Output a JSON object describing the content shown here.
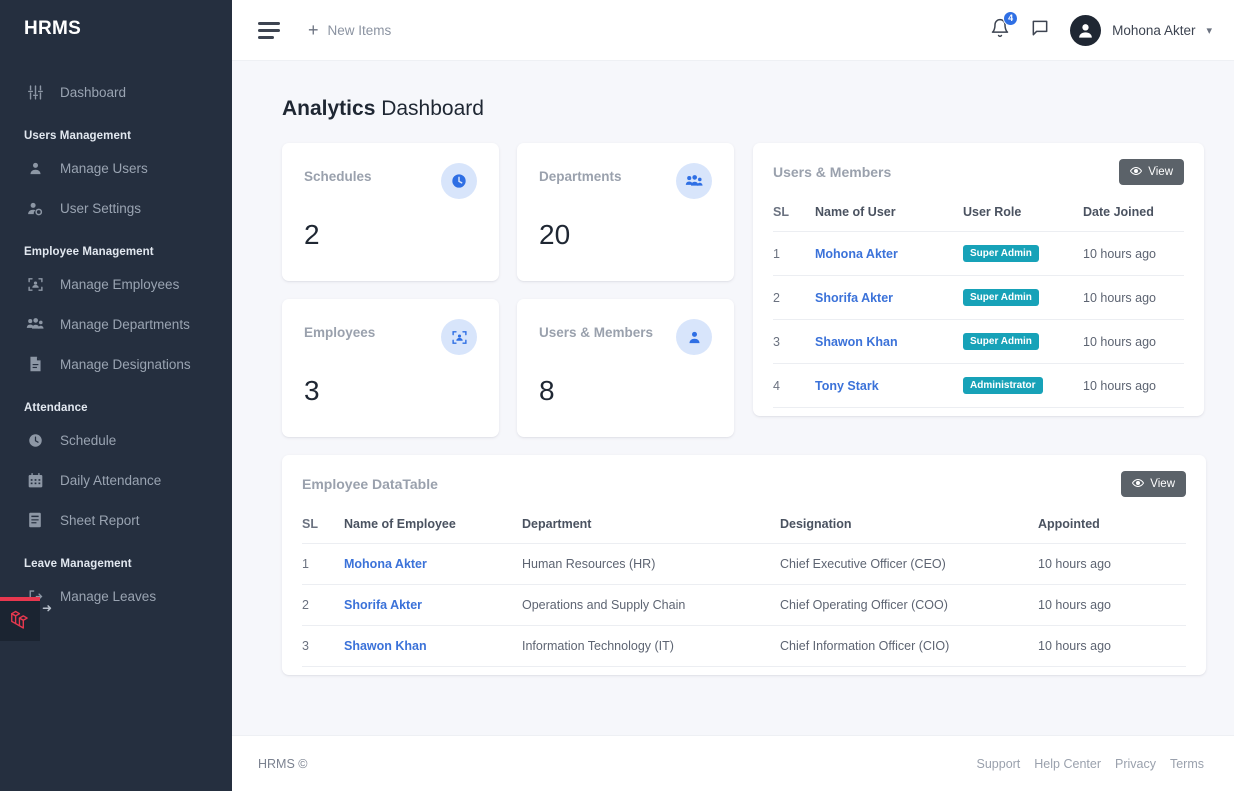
{
  "sidebar": {
    "brand": "HRMS",
    "groups": [
      {
        "header": null,
        "items": [
          {
            "label": "Dashboard",
            "icon": "sliders-icon"
          }
        ]
      },
      {
        "header": "Users Management",
        "items": [
          {
            "label": "Manage Users",
            "icon": "user-icon"
          },
          {
            "label": "User Settings",
            "icon": "user-gear-icon"
          }
        ]
      },
      {
        "header": "Employee Management",
        "items": [
          {
            "label": "Manage Employees",
            "icon": "employee-scan-icon"
          },
          {
            "label": "Manage Departments",
            "icon": "users-group-icon"
          },
          {
            "label": "Manage Designations",
            "icon": "document-icon"
          }
        ]
      },
      {
        "header": "Attendance",
        "items": [
          {
            "label": "Schedule",
            "icon": "clock-icon"
          },
          {
            "label": "Daily Attendance",
            "icon": "calendar-icon"
          },
          {
            "label": "Sheet Report",
            "icon": "report-icon"
          }
        ]
      },
      {
        "header": "Leave Management",
        "items": [
          {
            "label": "Manage Leaves",
            "icon": "leave-icon"
          }
        ]
      }
    ],
    "debugbar": {
      "name": "laravel-debugbar-toggle",
      "accent": "#e8384f"
    }
  },
  "topbar": {
    "menu_icon": "hamburger-icon",
    "new_items_label": "New Items",
    "new_items_icon": "plus-icon",
    "notifications": {
      "icon": "bell-icon",
      "count": "4",
      "badge_color": "#2f6fe4"
    },
    "messages": {
      "icon": "chat-bubble-icon"
    },
    "user": {
      "name": "Mohona Akter",
      "avatar_icon": "user-avatar-icon",
      "caret_icon": "chevron-down-icon"
    }
  },
  "page": {
    "title_bold": "Analytics",
    "title_rest": " Dashboard"
  },
  "stats": [
    {
      "label": "Schedules",
      "value": "2",
      "icon": "clock-icon"
    },
    {
      "label": "Departments",
      "value": "20",
      "icon": "users-group-icon"
    },
    {
      "label": "Employees",
      "value": "3",
      "icon": "employee-scan-icon"
    },
    {
      "label": "Users & Members",
      "value": "8",
      "icon": "user-icon"
    }
  ],
  "users_panel": {
    "title": "Users & Members",
    "view_label": "View",
    "view_icon": "eye-icon",
    "columns": [
      "SL",
      "Name of User",
      "User Role",
      "Date Joined"
    ],
    "rows": [
      {
        "sl": "1",
        "name": "Mohona Akter",
        "role": "Super Admin",
        "joined": "10 hours ago"
      },
      {
        "sl": "2",
        "name": "Shorifa Akter",
        "role": "Super Admin",
        "joined": "10 hours ago"
      },
      {
        "sl": "3",
        "name": "Shawon Khan",
        "role": "Super Admin",
        "joined": "10 hours ago"
      },
      {
        "sl": "4",
        "name": "Tony Stark",
        "role": "Administrator",
        "joined": "10 hours ago"
      }
    ],
    "badge_color": "#17a2b8"
  },
  "employee_panel": {
    "title": "Employee DataTable",
    "view_label": "View",
    "view_icon": "eye-icon",
    "columns": [
      "SL",
      "Name of Employee",
      "Department",
      "Designation",
      "Appointed"
    ],
    "rows": [
      {
        "sl": "1",
        "name": "Mohona Akter",
        "department": "Human Resources (HR)",
        "designation": "Chief Executive Officer (CEO)",
        "appointed": "10 hours ago"
      },
      {
        "sl": "2",
        "name": "Shorifa Akter",
        "department": "Operations and Supply Chain",
        "designation": "Chief Operating Officer (COO)",
        "appointed": "10 hours ago"
      },
      {
        "sl": "3",
        "name": "Shawon Khan",
        "department": "Information Technology (IT)",
        "designation": "Chief Information Officer (CIO)",
        "appointed": "10 hours ago"
      }
    ]
  },
  "footer": {
    "copyright": "HRMS ©",
    "links": [
      "Support",
      "Help Center",
      "Privacy",
      "Terms"
    ]
  },
  "theme": {
    "sidebar_bg": "#252f3f",
    "content_bg": "#f6f7fb",
    "link_blue": "#3b72d9",
    "accent_blue": "#2f6fe4",
    "badge_teal": "#17a2b8",
    "view_button": "#5b6269"
  }
}
